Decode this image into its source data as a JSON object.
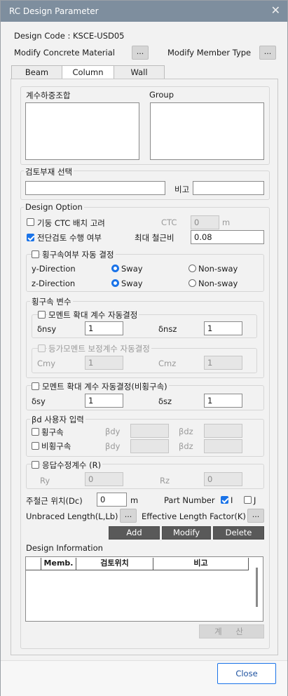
{
  "window": {
    "title": "RC Design Parameter"
  },
  "header": {
    "design_code": "Design Code : KSCE-USD05",
    "modify_concrete": "Modify Concrete Material",
    "modify_member": "Modify Member Type",
    "dots": "..."
  },
  "tabs": [
    {
      "label": "Beam"
    },
    {
      "label": "Column"
    },
    {
      "label": "Wall"
    }
  ],
  "load": {
    "combo_label": "계수하중조합",
    "group_label": "Group"
  },
  "check": {
    "legend": "검토부재 선택",
    "remark": "비고",
    "member_value": "",
    "remark_value": ""
  },
  "option": {
    "legend": "Design Option",
    "ctc_label": "기둥 CTC 배치 고려",
    "ctc_field": "CTC",
    "ctc_value": "0",
    "ctc_unit": "m",
    "shear_label": "전단검토 수행 여부",
    "max_ratio_label": "최대 철근비",
    "max_ratio_value": "0.08"
  },
  "brace": {
    "auto_label": "횡구속여부 자동 결정",
    "y_label": "y-Direction",
    "z_label": "z-Direction",
    "sway": "Sway",
    "nonsway": "Non-sway"
  },
  "var": {
    "legend": "횡구속 변수",
    "moment_auto": "모멘트 확대 계수 자동결정",
    "dnsy_label": "δnsy",
    "dnsy_value": "1",
    "dnsz_label": "δnsz",
    "dnsz_value": "1",
    "cm_auto": "등가모멘트 보정계수 자동결정",
    "cmy_label": "Cmy",
    "cmy_value": "1",
    "cmz_label": "Cmz",
    "cmz_value": "1"
  },
  "unbraced": {
    "moment_auto": "모멘트 확대 계수 자동결정(비횡구속)",
    "dsy_label": "δsy",
    "dsy_value": "1",
    "dsz_label": "δsz",
    "dsz_value": "1"
  },
  "beta": {
    "legend": "βd 사용자 입력",
    "braced_label": "횡구속",
    "unbraced_label": "비횡구속",
    "bdy": "βdy",
    "bdz": "βdz"
  },
  "response": {
    "label": "응답수정계수 (R)",
    "ry_label": "Ry",
    "ry_value": "0",
    "rz_label": "Rz",
    "rz_value": "0"
  },
  "rebar": {
    "pos_label": "주철근 위치(Dc)",
    "pos_value": "0",
    "unit": "m",
    "part_label": "Part Number",
    "part_i": "I",
    "part_j": "J",
    "unbraced_length": "Unbraced Length(L,Lb)",
    "effective_length": "Effective Length Factor(K)"
  },
  "actions": {
    "add": "Add",
    "modify": "Modify",
    "delete": "Delete"
  },
  "info": {
    "legend": "Design Information",
    "columns": [
      "Memb.",
      "검토위치",
      "비고"
    ]
  },
  "calc": "계 산",
  "close": "Close"
}
